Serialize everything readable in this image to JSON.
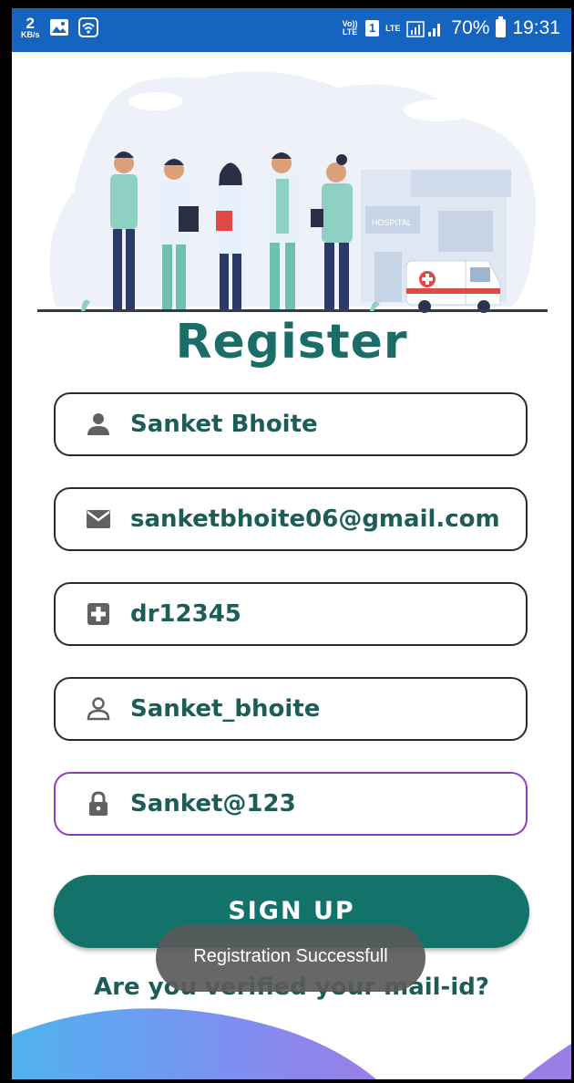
{
  "status_bar": {
    "speed_value": "2",
    "speed_unit": "KB/s",
    "volte": "Vo)) LTE",
    "sim": "1",
    "lte": "LTE",
    "battery": "70%",
    "time": "19:31"
  },
  "illustration": {
    "building_sign": "HOSPITAL"
  },
  "page": {
    "title": "Register"
  },
  "form": {
    "fields": [
      {
        "icon": "person-icon",
        "value": "Sanket Bhoite"
      },
      {
        "icon": "email-icon",
        "value": "sanketbhoite06@gmail.com"
      },
      {
        "icon": "medical-cross-icon",
        "value": "dr12345"
      },
      {
        "icon": "person-outline-icon",
        "value": "Sanket_bhoite"
      },
      {
        "icon": "lock-icon",
        "value": "Sanket@123"
      }
    ],
    "signup_label": "SIGN UP",
    "verify_link": "Are you verified your mail-id?"
  },
  "toast": {
    "message": "Registration Successfull"
  },
  "colors": {
    "status_bar": "#1565c0",
    "title": "#1b6e67",
    "button": "#13736a",
    "focused_border": "#8a3fb8"
  }
}
